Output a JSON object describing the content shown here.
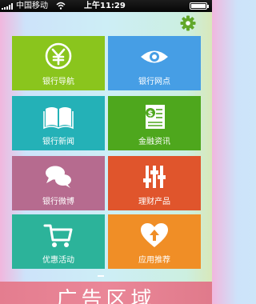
{
  "status_bar": {
    "carrier": "中国移动",
    "time": "上午11:29"
  },
  "tiles": [
    {
      "label": "银行导航",
      "icon": "yen-circle-icon",
      "color": "#8ac51d"
    },
    {
      "label": "银行网点",
      "icon": "eye-icon",
      "color": "#469ee5"
    },
    {
      "label": "银行新闻",
      "icon": "book-icon",
      "color": "#24b1b7"
    },
    {
      "label": "金融资讯",
      "icon": "dollar-document-icon",
      "color": "#4ea71d"
    },
    {
      "label": "银行微博",
      "icon": "chat-bubbles-icon",
      "color": "#b66b8f"
    },
    {
      "label": "理财产品",
      "icon": "sliders-icon",
      "color": "#e0552c"
    },
    {
      "label": "优惠活动",
      "icon": "shopping-cart-icon",
      "color": "#2cb39a"
    },
    {
      "label": "应用推荐",
      "icon": "heart-upload-icon",
      "color": "#f08e26"
    }
  ],
  "ad_banner": {
    "text": "广告区域"
  }
}
